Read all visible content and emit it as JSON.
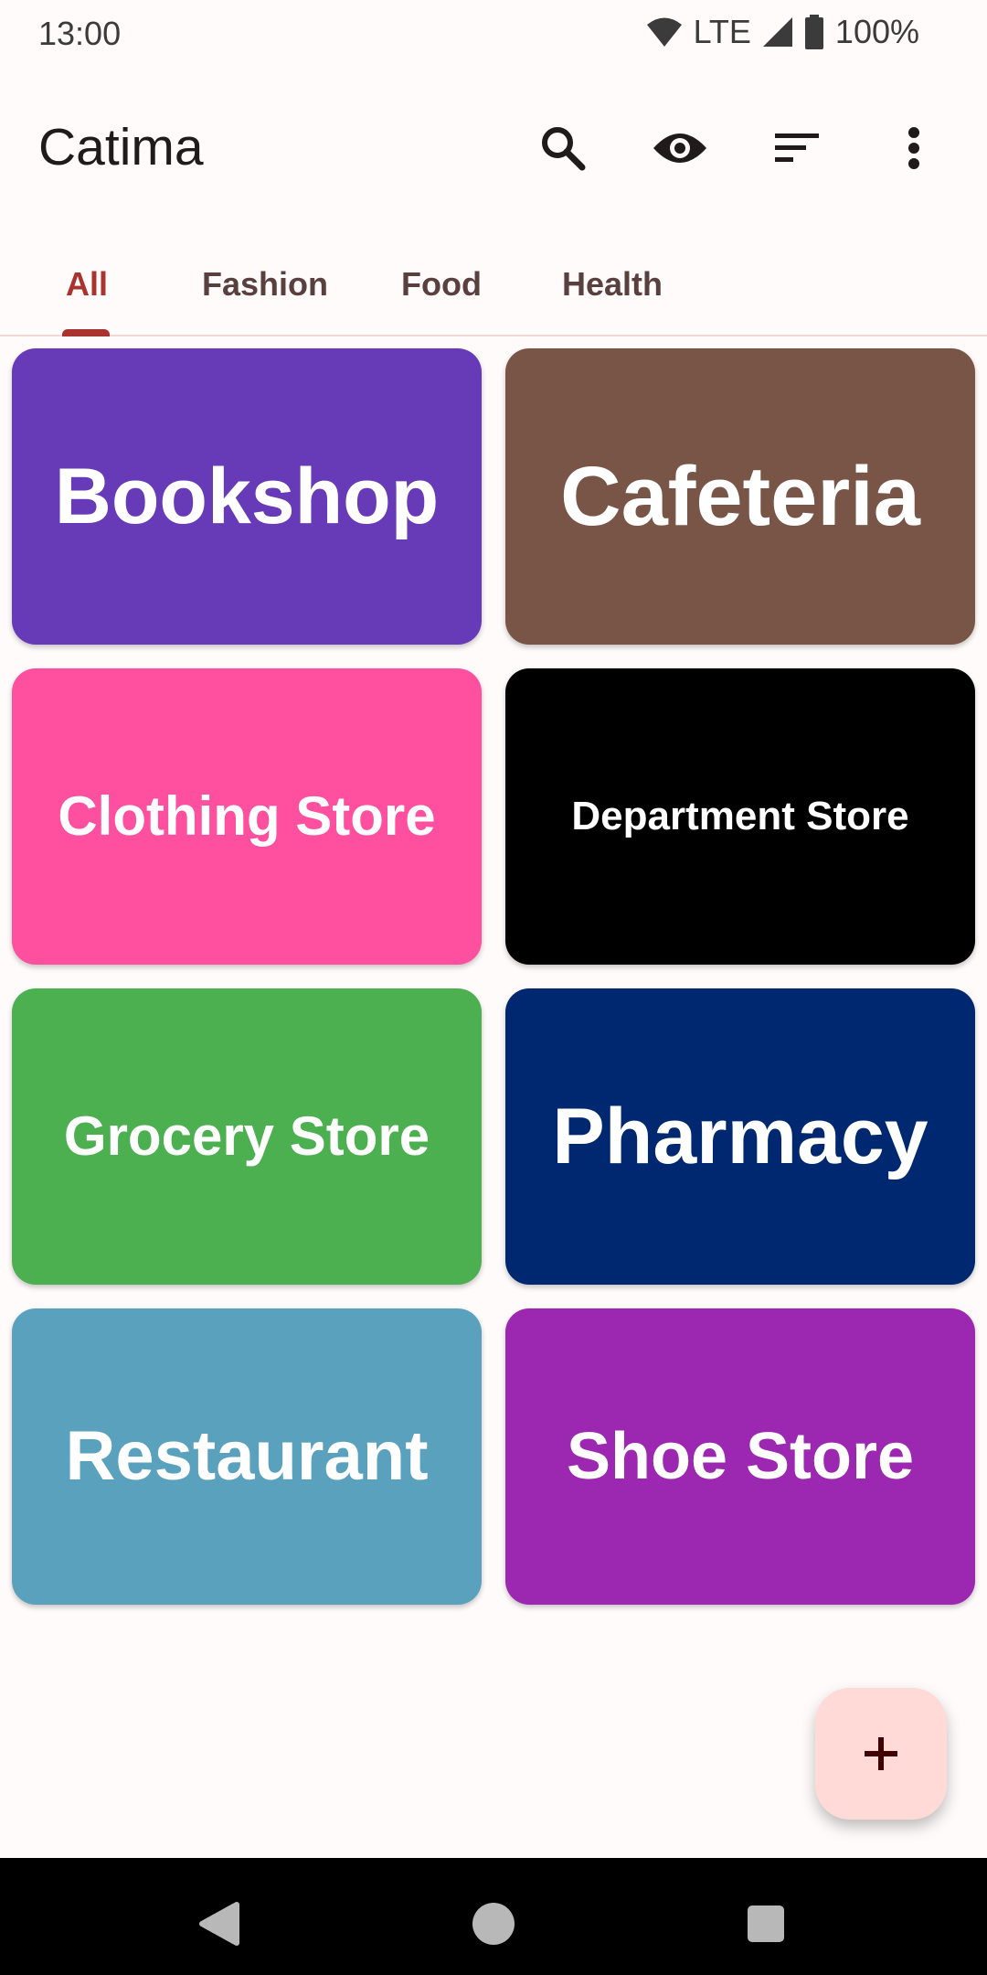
{
  "status": {
    "time": "13:00",
    "network": "LTE",
    "battery": "100%"
  },
  "app": {
    "title": "Catima",
    "actions": [
      "search-icon",
      "eye-icon",
      "sort-icon",
      "more-vert-icon"
    ]
  },
  "tabs": [
    {
      "label": "All",
      "active": true
    },
    {
      "label": "Fashion",
      "active": false
    },
    {
      "label": "Food",
      "active": false
    },
    {
      "label": "Health",
      "active": false
    }
  ],
  "cards": [
    {
      "name": "Bookshop",
      "color": "#673ab7"
    },
    {
      "name": "Cafeteria",
      "color": "#795548"
    },
    {
      "name": "Clothing Store",
      "color": "#ff4f9f"
    },
    {
      "name": "Department Store",
      "color": "#000000"
    },
    {
      "name": "Grocery Store",
      "color": "#4caf50"
    },
    {
      "name": "Pharmacy",
      "color": "#002870"
    },
    {
      "name": "Restaurant",
      "color": "#5aa1be"
    },
    {
      "name": "Shoe Store",
      "color": "#9c27b0"
    }
  ],
  "fab": {
    "icon": "plus-icon",
    "symbol": "+"
  },
  "nav": [
    "back-icon",
    "home-icon",
    "recents-icon"
  ],
  "colors": {
    "accent": "#a8332f",
    "fab_bg": "#ffdad6",
    "background": "#fffbfb"
  }
}
